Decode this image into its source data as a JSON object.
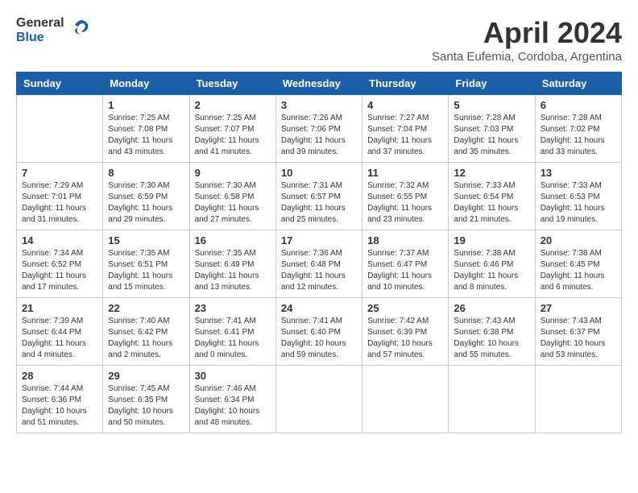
{
  "header": {
    "logo_general": "General",
    "logo_blue": "Blue",
    "month_title": "April 2024",
    "subtitle": "Santa Eufemia, Cordoba, Argentina"
  },
  "calendar": {
    "days_of_week": [
      "Sunday",
      "Monday",
      "Tuesday",
      "Wednesday",
      "Thursday",
      "Friday",
      "Saturday"
    ],
    "weeks": [
      [
        {
          "day": "",
          "info": ""
        },
        {
          "day": "1",
          "info": "Sunrise: 7:25 AM\nSunset: 7:08 PM\nDaylight: 11 hours\nand 43 minutes."
        },
        {
          "day": "2",
          "info": "Sunrise: 7:25 AM\nSunset: 7:07 PM\nDaylight: 11 hours\nand 41 minutes."
        },
        {
          "day": "3",
          "info": "Sunrise: 7:26 AM\nSunset: 7:06 PM\nDaylight: 11 hours\nand 39 minutes."
        },
        {
          "day": "4",
          "info": "Sunrise: 7:27 AM\nSunset: 7:04 PM\nDaylight: 11 hours\nand 37 minutes."
        },
        {
          "day": "5",
          "info": "Sunrise: 7:28 AM\nSunset: 7:03 PM\nDaylight: 11 hours\nand 35 minutes."
        },
        {
          "day": "6",
          "info": "Sunrise: 7:28 AM\nSunset: 7:02 PM\nDaylight: 11 hours\nand 33 minutes."
        }
      ],
      [
        {
          "day": "7",
          "info": "Sunrise: 7:29 AM\nSunset: 7:01 PM\nDaylight: 11 hours\nand 31 minutes."
        },
        {
          "day": "8",
          "info": "Sunrise: 7:30 AM\nSunset: 6:59 PM\nDaylight: 11 hours\nand 29 minutes."
        },
        {
          "day": "9",
          "info": "Sunrise: 7:30 AM\nSunset: 6:58 PM\nDaylight: 11 hours\nand 27 minutes."
        },
        {
          "day": "10",
          "info": "Sunrise: 7:31 AM\nSunset: 6:57 PM\nDaylight: 11 hours\nand 25 minutes."
        },
        {
          "day": "11",
          "info": "Sunrise: 7:32 AM\nSunset: 6:55 PM\nDaylight: 11 hours\nand 23 minutes."
        },
        {
          "day": "12",
          "info": "Sunrise: 7:33 AM\nSunset: 6:54 PM\nDaylight: 11 hours\nand 21 minutes."
        },
        {
          "day": "13",
          "info": "Sunrise: 7:33 AM\nSunset: 6:53 PM\nDaylight: 11 hours\nand 19 minutes."
        }
      ],
      [
        {
          "day": "14",
          "info": "Sunrise: 7:34 AM\nSunset: 6:52 PM\nDaylight: 11 hours\nand 17 minutes."
        },
        {
          "day": "15",
          "info": "Sunrise: 7:35 AM\nSunset: 6:51 PM\nDaylight: 11 hours\nand 15 minutes."
        },
        {
          "day": "16",
          "info": "Sunrise: 7:35 AM\nSunset: 6:49 PM\nDaylight: 11 hours\nand 13 minutes."
        },
        {
          "day": "17",
          "info": "Sunrise: 7:36 AM\nSunset: 6:48 PM\nDaylight: 11 hours\nand 12 minutes."
        },
        {
          "day": "18",
          "info": "Sunrise: 7:37 AM\nSunset: 6:47 PM\nDaylight: 11 hours\nand 10 minutes."
        },
        {
          "day": "19",
          "info": "Sunrise: 7:38 AM\nSunset: 6:46 PM\nDaylight: 11 hours\nand 8 minutes."
        },
        {
          "day": "20",
          "info": "Sunrise: 7:38 AM\nSunset: 6:45 PM\nDaylight: 11 hours\nand 6 minutes."
        }
      ],
      [
        {
          "day": "21",
          "info": "Sunrise: 7:39 AM\nSunset: 6:44 PM\nDaylight: 11 hours\nand 4 minutes."
        },
        {
          "day": "22",
          "info": "Sunrise: 7:40 AM\nSunset: 6:42 PM\nDaylight: 11 hours\nand 2 minutes."
        },
        {
          "day": "23",
          "info": "Sunrise: 7:41 AM\nSunset: 6:41 PM\nDaylight: 11 hours\nand 0 minutes."
        },
        {
          "day": "24",
          "info": "Sunrise: 7:41 AM\nSunset: 6:40 PM\nDaylight: 10 hours\nand 59 minutes."
        },
        {
          "day": "25",
          "info": "Sunrise: 7:42 AM\nSunset: 6:39 PM\nDaylight: 10 hours\nand 57 minutes."
        },
        {
          "day": "26",
          "info": "Sunrise: 7:43 AM\nSunset: 6:38 PM\nDaylight: 10 hours\nand 55 minutes."
        },
        {
          "day": "27",
          "info": "Sunrise: 7:43 AM\nSunset: 6:37 PM\nDaylight: 10 hours\nand 53 minutes."
        }
      ],
      [
        {
          "day": "28",
          "info": "Sunrise: 7:44 AM\nSunset: 6:36 PM\nDaylight: 10 hours\nand 51 minutes."
        },
        {
          "day": "29",
          "info": "Sunrise: 7:45 AM\nSunset: 6:35 PM\nDaylight: 10 hours\nand 50 minutes."
        },
        {
          "day": "30",
          "info": "Sunrise: 7:46 AM\nSunset: 6:34 PM\nDaylight: 10 hours\nand 48 minutes."
        },
        {
          "day": "",
          "info": ""
        },
        {
          "day": "",
          "info": ""
        },
        {
          "day": "",
          "info": ""
        },
        {
          "day": "",
          "info": ""
        }
      ]
    ]
  }
}
